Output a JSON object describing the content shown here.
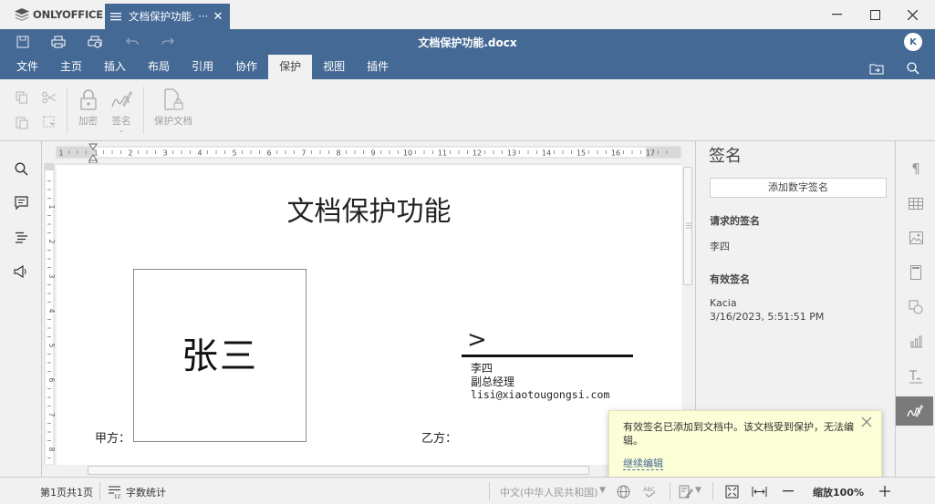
{
  "app": {
    "logo_text": "ONLYOFFICE",
    "tab_label": "文档保护功能. ···",
    "doc_title": "文档保护功能.docx",
    "avatar_initial": "K"
  },
  "menu": {
    "items": [
      "文件",
      "主页",
      "插入",
      "布局",
      "引用",
      "协作",
      "保护",
      "视图",
      "插件"
    ],
    "active": "保护"
  },
  "toolbar": {
    "encrypt_label": "加密",
    "signature_label": "签名",
    "protect_label": "保护文档"
  },
  "ruler": {
    "h_marks": [
      "1",
      "1",
      "2",
      "3",
      "4",
      "5",
      "6",
      "7",
      "8",
      "9",
      "10",
      "11",
      "12",
      "13",
      "14",
      "15",
      "16",
      "17"
    ],
    "v_marks": [
      "1",
      "2",
      "3",
      "4",
      "5",
      "6",
      "7",
      "8"
    ]
  },
  "document": {
    "heading": "文档保护功能",
    "sigbox_name": "张三",
    "party_a": "甲方：",
    "party_b": "乙方：",
    "sig_mark": ">",
    "signer_name": "李四",
    "signer_title": "副总经理",
    "signer_email": "lisi@xiaotougongsi.com"
  },
  "panel": {
    "title": "签名",
    "add_button": "添加数字签名",
    "requested_header": "请求的签名",
    "requested_name": "李四",
    "valid_header": "有效签名",
    "valid_name": "Kacia",
    "valid_time": "3/16/2023, 5:51:51 PM"
  },
  "notification": {
    "text": "有效签名已添加到文档中。该文档受到保护，无法编辑。",
    "link": "继续编辑"
  },
  "status": {
    "page": "第1页共1页",
    "word_count": "字数统计",
    "language": "中文(中华人民共和国)",
    "zoom": "缩放100%"
  },
  "colors": {
    "accent": "#446995",
    "notification_bg": "#fcfed7"
  }
}
